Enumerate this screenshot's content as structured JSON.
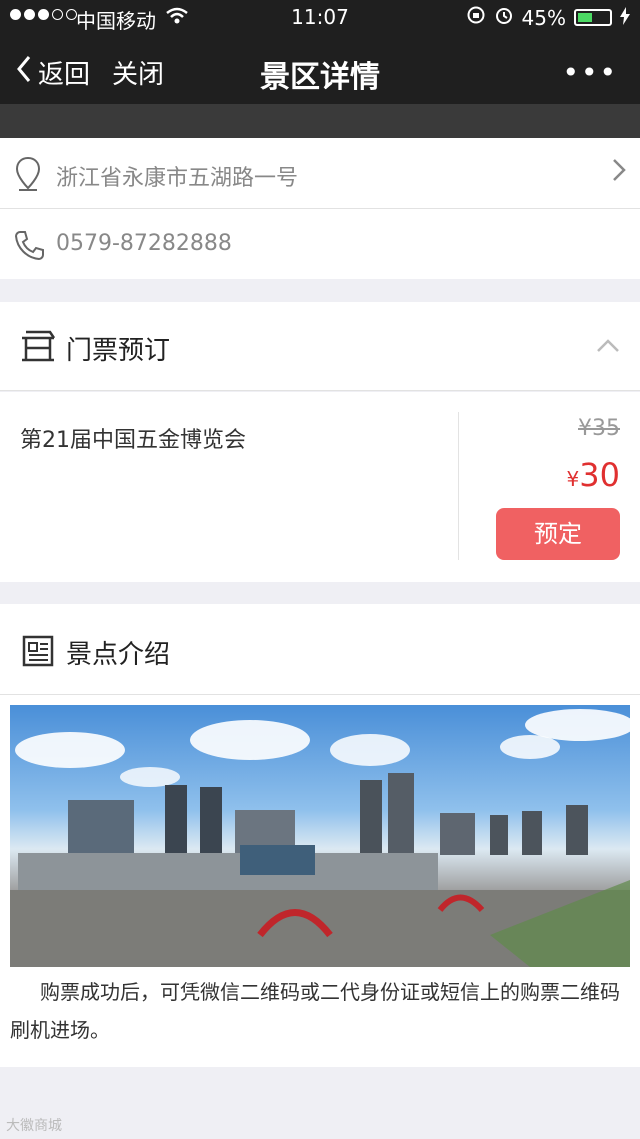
{
  "status_bar": {
    "carrier": "中国移动",
    "time": "11:07",
    "battery": "45%",
    "battery_level": 0.45
  },
  "nav": {
    "back_label": "返回",
    "close_label": "关闭",
    "title": "景区详情",
    "more_label": "•••"
  },
  "info": {
    "address": "浙江省永康市五湖路一号",
    "phone": "0579-87282888"
  },
  "tickets_section": {
    "heading": "门票预订",
    "items": [
      {
        "name": "第21届中国五金博览会",
        "original_price": "¥35",
        "currency": "¥",
        "price": "30",
        "book_label": "预定"
      }
    ]
  },
  "intro_section": {
    "heading": "景点介绍",
    "description": "购票成功后，可凭微信二维码或二代身份证或短信上的购票二维码刷机进场。"
  },
  "watermark": "大徽商城",
  "colors": {
    "accent": "#f06162",
    "price": "#e03030",
    "nav_bg": "#1f1f1f"
  }
}
